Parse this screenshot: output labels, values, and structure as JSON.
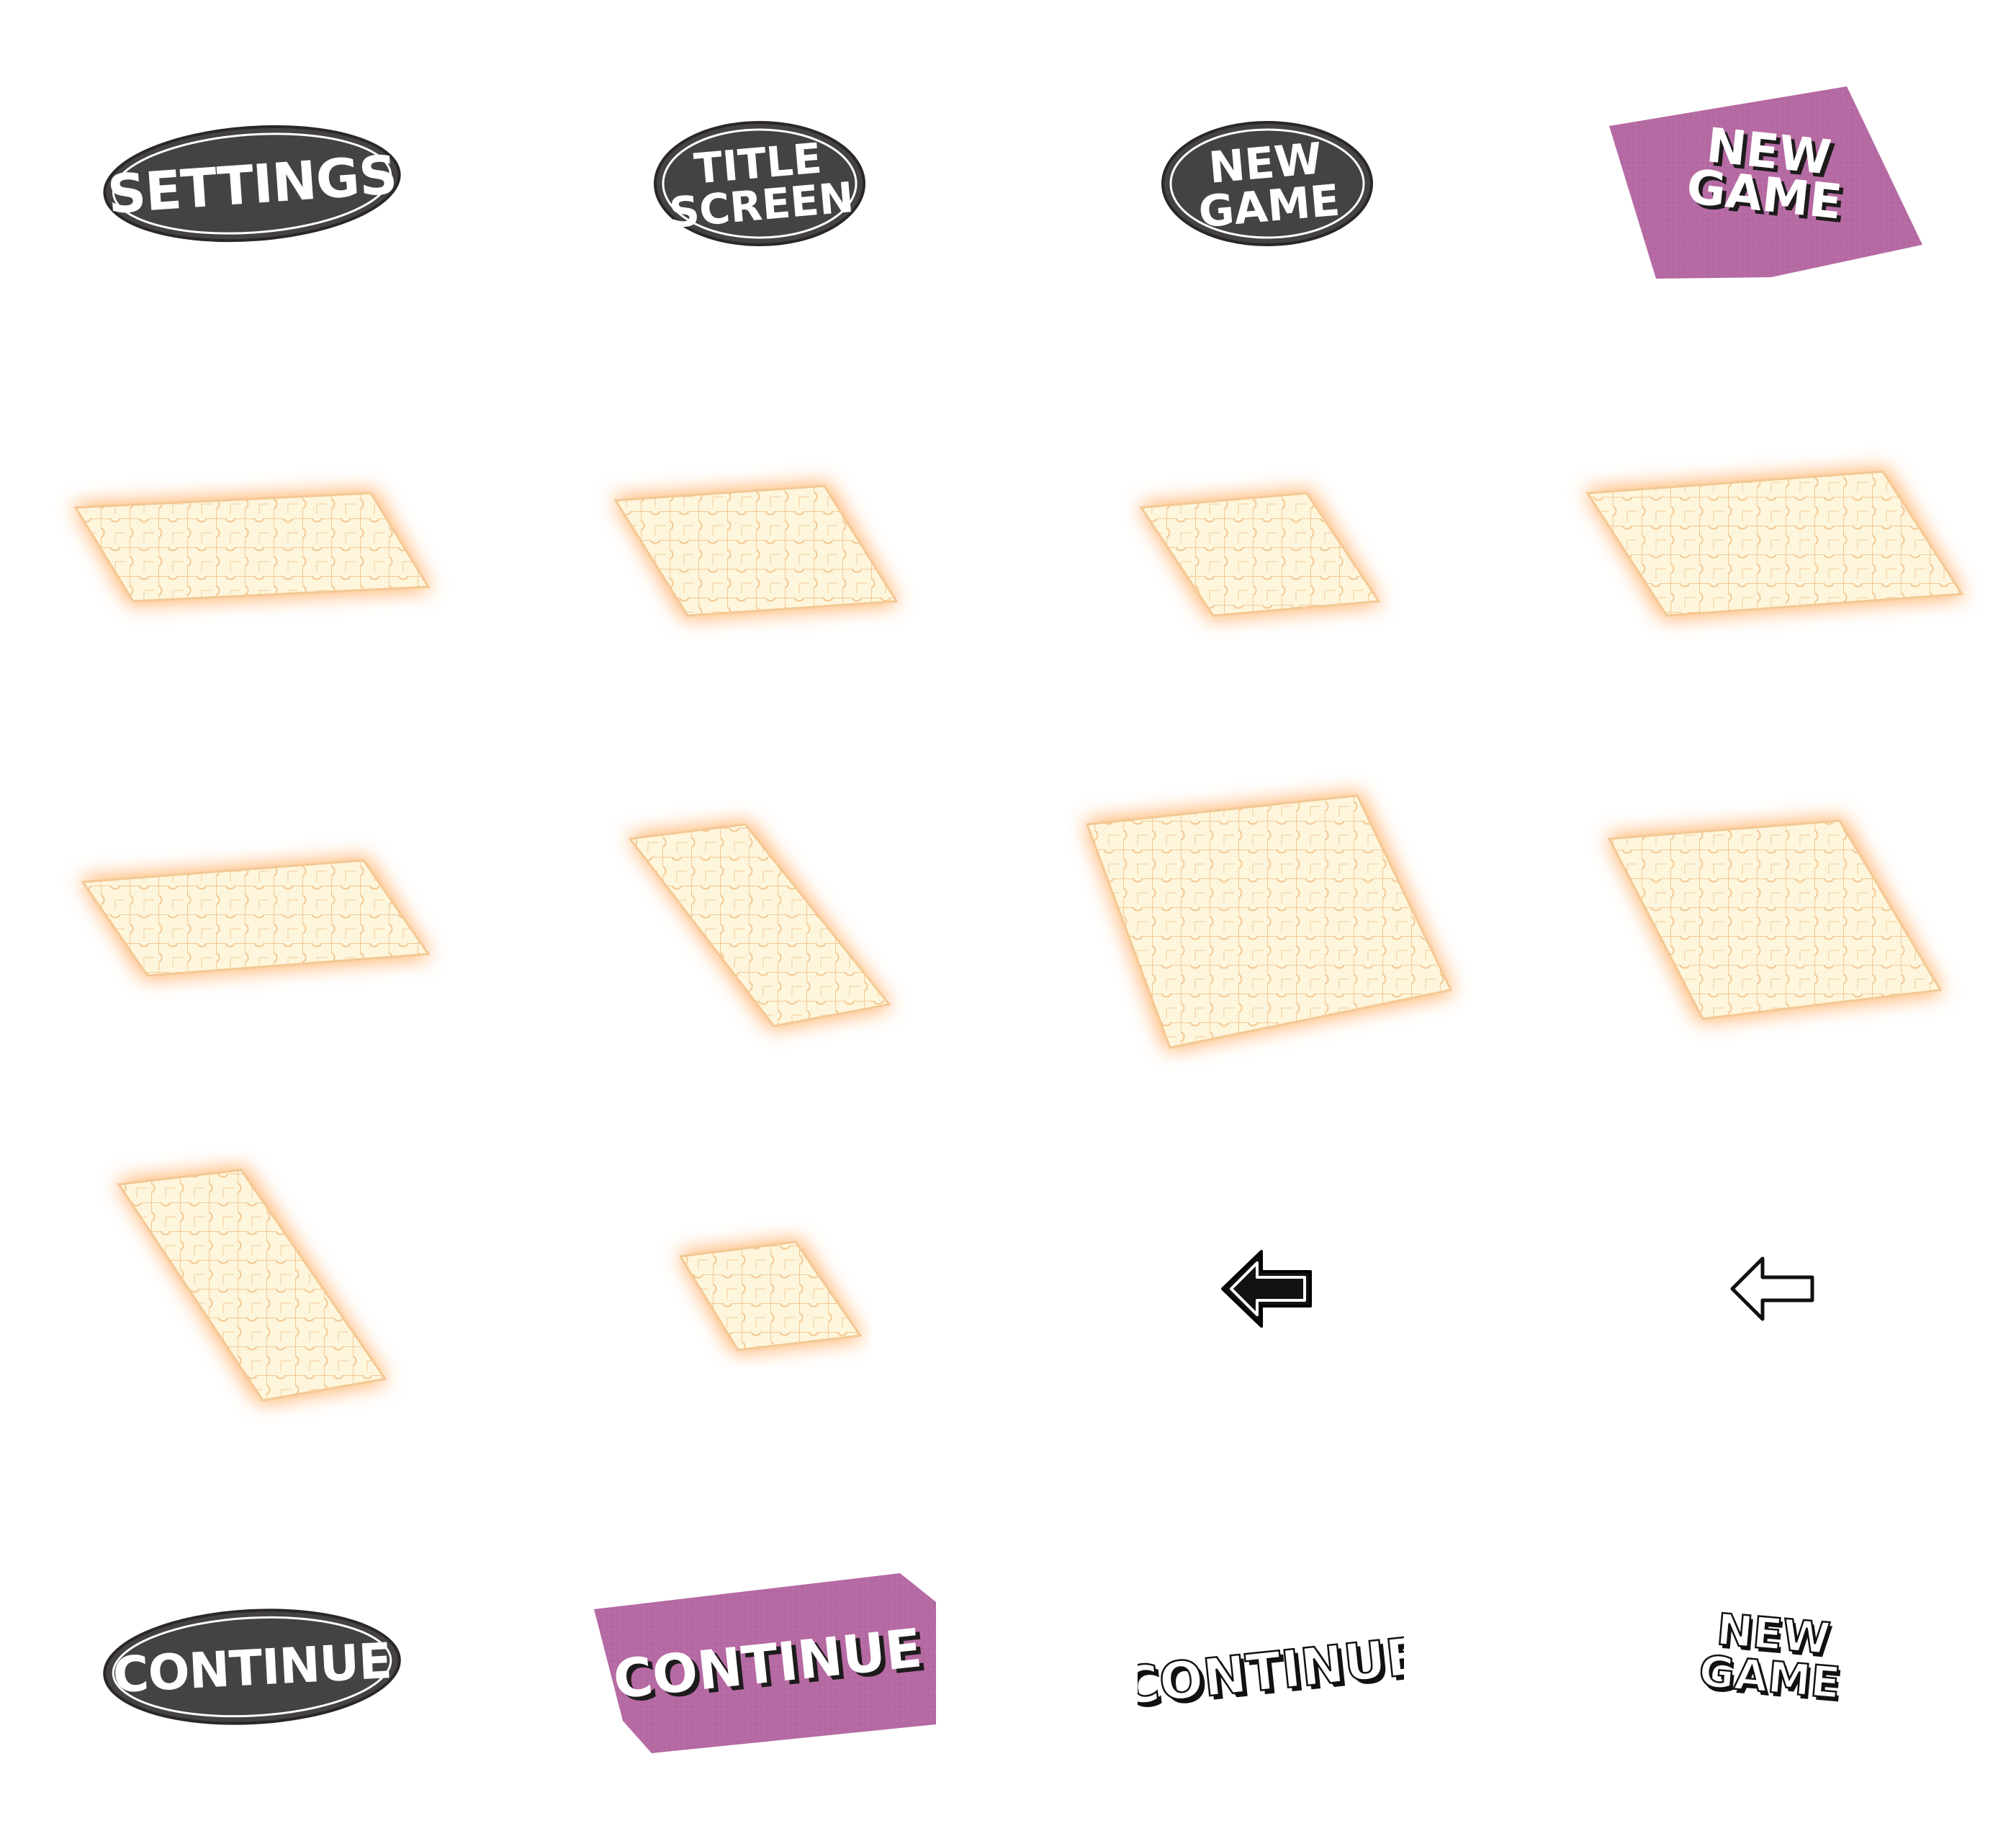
{
  "buttons": {
    "settings_oval": {
      "lines": [
        "SETTINGS"
      ]
    },
    "title_screen_oval": {
      "lines": [
        "TITLE",
        "SCREEN"
      ]
    },
    "new_game_oval": {
      "lines": [
        "NEW",
        "GAME"
      ]
    },
    "new_game_tag": {
      "lines": [
        "NEW",
        "GAME"
      ]
    },
    "continue_oval": {
      "lines": [
        "CONTINUE"
      ]
    },
    "continue_tag": {
      "lines": [
        "CONTINUE"
      ]
    },
    "continue_plain": {
      "lines": [
        "CONTINUE"
      ]
    },
    "new_game_plain": {
      "lines": [
        "NEW",
        "GAME"
      ]
    }
  },
  "icons": {
    "back_arrow_filled": "arrow-left-icon",
    "back_arrow_outline": "arrow-left-outline-icon"
  },
  "puzzle_boards": [
    {
      "name": "puzzle-board-1"
    },
    {
      "name": "puzzle-board-2"
    },
    {
      "name": "puzzle-board-3"
    },
    {
      "name": "puzzle-board-4"
    },
    {
      "name": "puzzle-board-5"
    },
    {
      "name": "puzzle-board-6"
    },
    {
      "name": "puzzle-board-7"
    },
    {
      "name": "puzzle-board-8"
    },
    {
      "name": "puzzle-board-9"
    },
    {
      "name": "puzzle-board-10"
    }
  ],
  "colors": {
    "oval_fill": "#454243",
    "oval_ring": "#ffffff",
    "oval_outline": "#2b2728",
    "tag_fill": "#b56aa3",
    "text_fill": "#ffffff",
    "text_shadow": "#1e1b1c",
    "puzzle_fill": "#fdf6dc",
    "puzzle_lines": "#f4c894",
    "puzzle_glow": "#ff9a3c",
    "arrow_fill": "#111111"
  }
}
